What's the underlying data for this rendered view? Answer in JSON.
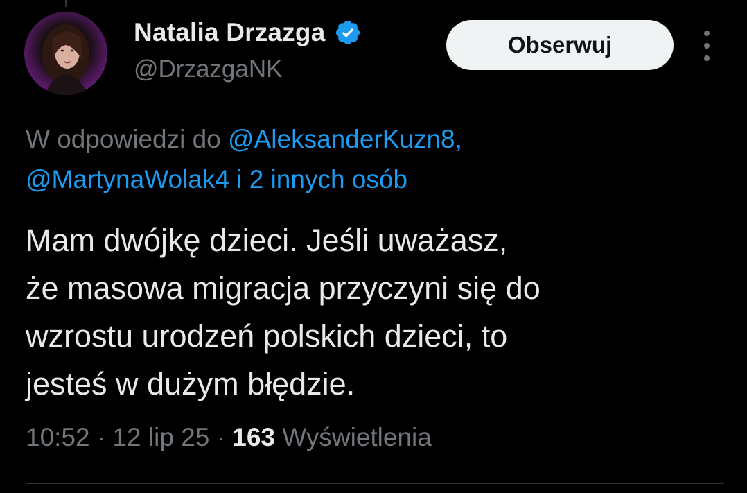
{
  "author": {
    "display_name": "Natalia Drzazga",
    "handle": "@DrzazgaNK",
    "verified": true,
    "verified_color": "#1d9bf0"
  },
  "actions": {
    "follow_label": "Obserwuj",
    "more_icon": "more-vertical-icon"
  },
  "reply_context": {
    "prefix": "W odpowiedzi do ",
    "mention_1": "@AleksanderKuzn8,",
    "mention_2": "@MartynaWolak4",
    "suffix": " i 2 innych osób"
  },
  "tweet": {
    "lines": [
      "Mam dwójkę dzieci. Jeśli uważasz,",
      "że masowa migracja przyczyni się do",
      "wzrostu urodzeń polskich dzieci, to",
      "jesteś w dużym błędzie."
    ]
  },
  "meta": {
    "time": "10:52",
    "separator": " · ",
    "date": "12 lip 25",
    "views_count": "163",
    "views_label": " Wyświetlenia"
  },
  "colors": {
    "background": "#000000",
    "text_primary": "#e7e9ea",
    "text_secondary": "#71767b",
    "accent": "#1d9bf0",
    "follow_bg": "#eff3f4"
  }
}
